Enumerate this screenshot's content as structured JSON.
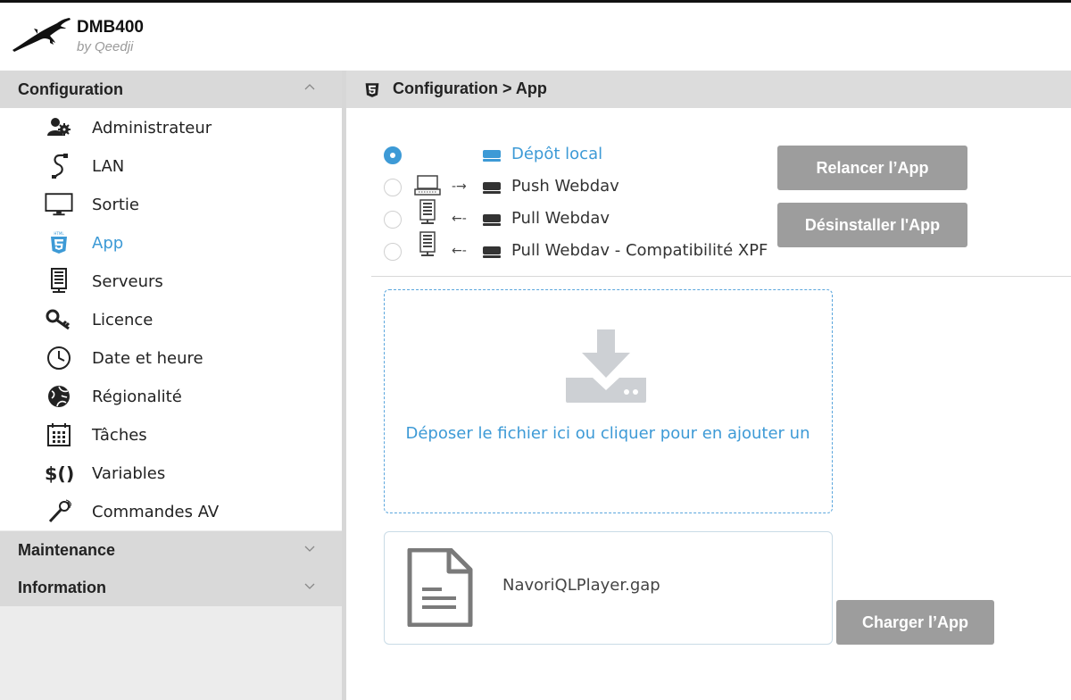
{
  "app": {
    "title": "DMB400",
    "subtitle": "by Qeedji"
  },
  "sidebar": {
    "sections": [
      {
        "label": "Configuration",
        "expanded": true
      },
      {
        "label": "Maintenance",
        "expanded": false
      },
      {
        "label": "Information",
        "expanded": false
      }
    ],
    "items": [
      {
        "label": "Administrateur",
        "icon": "admin-users-icon"
      },
      {
        "label": "LAN",
        "icon": "cable-icon"
      },
      {
        "label": "Sortie",
        "icon": "monitor-icon"
      },
      {
        "label": "App",
        "icon": "html5-icon",
        "active": true
      },
      {
        "label": "Serveurs",
        "icon": "server-icon"
      },
      {
        "label": "Licence",
        "icon": "key-icon"
      },
      {
        "label": "Date et heure",
        "icon": "clock-icon"
      },
      {
        "label": "Régionalité",
        "icon": "globe-icon"
      },
      {
        "label": "Tâches",
        "icon": "calendar-icon"
      },
      {
        "label": "Variables",
        "icon": "variables-icon"
      },
      {
        "label": "Commandes AV",
        "icon": "microphone-icon"
      }
    ]
  },
  "main": {
    "breadcrumb": "Configuration > App",
    "sources": [
      {
        "label": "Dépôt local",
        "checked": true,
        "arrow": "",
        "source_icon": ""
      },
      {
        "label": "Push Webdav",
        "checked": false,
        "arrow": "-→",
        "source_icon": "computer-icon"
      },
      {
        "label": "Pull Webdav",
        "checked": false,
        "arrow": "←-",
        "source_icon": "server-icon"
      },
      {
        "label": "Pull Webdav - Compatibilité XPF",
        "checked": false,
        "arrow": "←-",
        "source_icon": "server-icon"
      }
    ],
    "buttons": {
      "relaunch": "Relancer l’App",
      "uninstall": "Désinstaller l'App",
      "load": "Charger l’App"
    },
    "dropzone_text": "Déposer le fichier ici ou cliquer pour en ajouter un",
    "file_name": "NavoriQLPlayer.gap"
  },
  "colors": {
    "accent": "#3d9ad6",
    "button": "#9d9d9d",
    "section_bg": "#d9d9d9"
  }
}
